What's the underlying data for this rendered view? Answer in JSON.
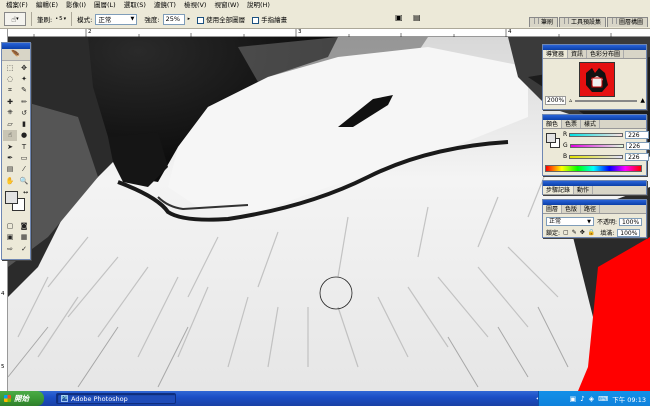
{
  "menu": [
    "檔案(F)",
    "編輯(E)",
    "影像(I)",
    "圖層(L)",
    "選取(S)",
    "濾鏡(T)",
    "檢視(V)",
    "視窗(W)",
    "說明(H)"
  ],
  "options": {
    "tool_icon": "smudge-tool-icon",
    "brush_label": "筆刷:",
    "brush_size": "5",
    "mode_label": "模式:",
    "mode_value": "正常",
    "strength_label": "強度:",
    "strength_value": "25%",
    "all_layers_label": "使用全部圖層",
    "finger_painting_label": "手指繪畫",
    "palette_tabs": [
      "筆刷",
      "工具預設集",
      "圖層構圖"
    ]
  },
  "rulers": {
    "top_labels": [
      "2",
      "3",
      "4"
    ],
    "left_labels": [
      "1",
      "2",
      "3",
      "4",
      "5"
    ]
  },
  "navigator": {
    "tabs": [
      "導覽器",
      "資訊",
      "色彩分布圖"
    ],
    "zoom": "200%",
    "thumb_color": "#e51010"
  },
  "color_panel": {
    "tabs": [
      "顏色",
      "色票",
      "樣式"
    ],
    "rows": [
      {
        "label": "R",
        "value": "226"
      },
      {
        "label": "G",
        "value": "226"
      },
      {
        "label": "B",
        "value": "226"
      }
    ]
  },
  "history_panel": {
    "tabs": [
      "步驟記錄",
      "動作"
    ]
  },
  "layers_panel": {
    "tabs": [
      "圖層",
      "色版",
      "路徑"
    ],
    "blend_mode": "正常",
    "opacity_label": "不透明:",
    "opacity_value": "100%",
    "lock_label": "鎖定:",
    "fill_label": "填滿:",
    "fill_value": "100%"
  },
  "taskbar": {
    "start_label": "開始",
    "app_button": "Adobe Photoshop",
    "clock": "下午 09:13",
    "start_color": "#3b9a36"
  },
  "canvas": {
    "foreground_color": "#e3e3e3",
    "background_color": "#ffffff",
    "accent_red": "#ff0000"
  }
}
